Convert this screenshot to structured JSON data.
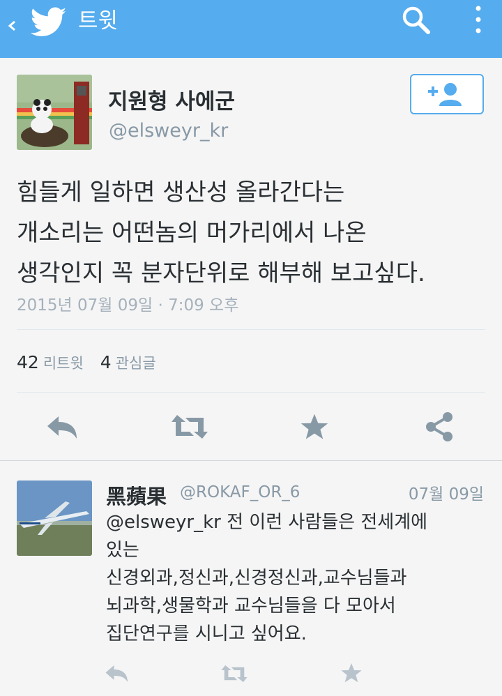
{
  "header": {
    "title": "트윗",
    "icons": {
      "back": "chevron-left-icon",
      "logo": "twitter-bird-icon",
      "search": "search-icon",
      "more": "more-vertical-icon"
    },
    "color": "#55acee"
  },
  "tweet": {
    "display_name": "지원형 사에군",
    "handle": "@elsweyr_kr",
    "text": "힘들게 일하면 생산성 올라간다는\n개소리는 어떤놈의 머가리에서 나온\n생각인지 꼭 분자단위로 해부해 보고싶다.",
    "timestamp": "2015년 07월 09일 · 7:09 오후",
    "retweet_count": "42",
    "retweet_label": "리트윗",
    "favorite_count": "4",
    "favorite_label": "관심글",
    "follow_icon": "add-user-icon"
  },
  "actions": [
    "reply-icon",
    "retweet-icon",
    "star-icon",
    "share-icon"
  ],
  "reply": {
    "display_name": "黑蘋果",
    "handle": "@ROKAF_OR_6",
    "date": "07월 09일",
    "mention": "@elsweyr_kr",
    "text_after_mention": " 전 이런 사람들은 전세계에\n있는\n신경외과,정신과,신경정신과,교수님들과\n뇌과학,생물학과 교수님들을 다 모아서\n집단연구를 시니고 싶어요."
  }
}
